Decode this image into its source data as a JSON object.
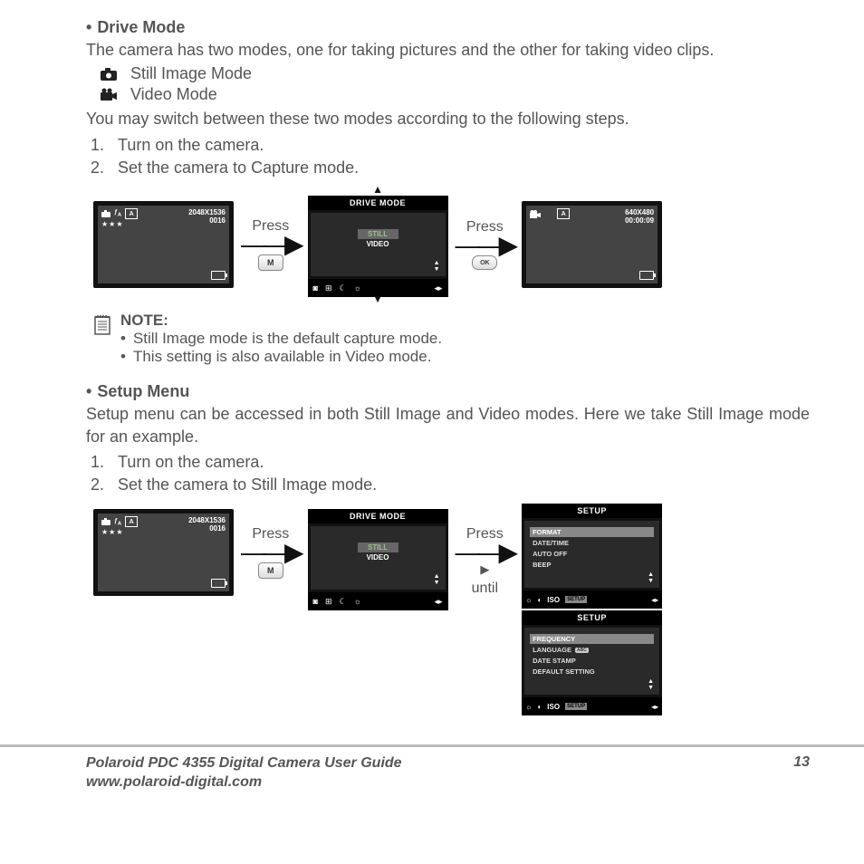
{
  "section1": {
    "title": "Drive Mode",
    "intro": "The camera has two modes, one for taking pictures and the other for taking video clips.",
    "still_label": "Still Image Mode",
    "video_label": "Video Mode",
    "switch_text": "You may switch between these two modes according to the following steps.",
    "step1": "Turn on the camera.",
    "step2": "Set the camera to Capture mode."
  },
  "fig1": {
    "press": "Press",
    "btn_m": "M",
    "btn_ok": "OK",
    "screen1": {
      "res": "2048X1536",
      "count": "0016",
      "a": "A",
      "flash": "ƒA"
    },
    "menu": {
      "title": "DRIVE MODE",
      "item_sel": "STILL",
      "item2": "VIDEO"
    },
    "screen2": {
      "res": "640X480",
      "time": "00:00:09",
      "a": "A"
    }
  },
  "note": {
    "title": "NOTE:",
    "item1": "Still Image mode is the default capture mode.",
    "item2": "This setting is also available in Video mode."
  },
  "section2": {
    "title": "Setup Menu",
    "intro": "Setup menu can be accessed in both Still Image and Video modes. Here we take Still Image mode for an example.",
    "step1": "Turn on the camera.",
    "step2": "Set the camera to Still Image mode."
  },
  "fig2": {
    "press": "Press",
    "until": "until",
    "btn_m": "M",
    "screen1": {
      "res": "2048X1536",
      "count": "0016",
      "a": "A",
      "flash": "ƒA"
    },
    "menu": {
      "title": "DRIVE MODE",
      "item_sel": "STILL",
      "item2": "VIDEO"
    },
    "setup1": {
      "title": "SETUP",
      "i1": "FORMAT",
      "i2": "DATE/TIME",
      "i3": "AUTO OFF",
      "i4": "BEEP",
      "iso": "ISO",
      "tag": "SETUP"
    },
    "setup2": {
      "title": "SETUP",
      "i1": "FREQUENCY",
      "i2": "LANGUAGE",
      "i3": "DATE STAMP",
      "i4": "DEFAULT SETTING",
      "abc": "ABC",
      "iso": "ISO",
      "tag": "SETUP"
    }
  },
  "footer": {
    "title": "Polaroid PDC 4355 Digital Camera User Guide",
    "url": "www.polaroid-digital.com",
    "page": "13"
  }
}
